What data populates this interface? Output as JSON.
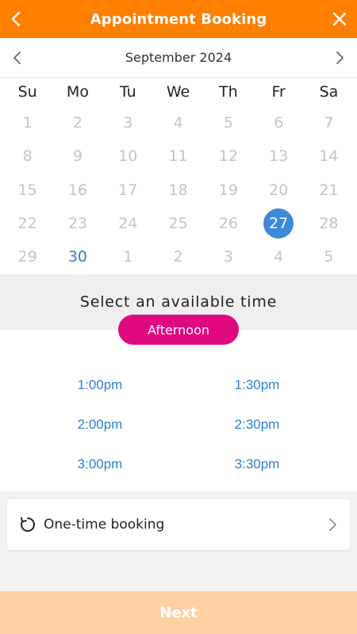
{
  "header": {
    "title": "Appointment Booking",
    "back_icon": "chevron-left-icon",
    "close_icon": "close-icon",
    "bg_color": "#ff7f00"
  },
  "calendar": {
    "month_label": "September 2024",
    "weekdays": [
      "Su",
      "Mo",
      "Tu",
      "We",
      "Th",
      "Fr",
      "Sa"
    ],
    "days": [
      {
        "label": "1",
        "state": "disabled"
      },
      {
        "label": "2",
        "state": "disabled"
      },
      {
        "label": "3",
        "state": "disabled"
      },
      {
        "label": "4",
        "state": "disabled"
      },
      {
        "label": "5",
        "state": "disabled"
      },
      {
        "label": "6",
        "state": "disabled"
      },
      {
        "label": "7",
        "state": "disabled"
      },
      {
        "label": "8",
        "state": "disabled"
      },
      {
        "label": "9",
        "state": "disabled"
      },
      {
        "label": "10",
        "state": "disabled"
      },
      {
        "label": "11",
        "state": "disabled"
      },
      {
        "label": "12",
        "state": "disabled"
      },
      {
        "label": "13",
        "state": "disabled"
      },
      {
        "label": "14",
        "state": "disabled"
      },
      {
        "label": "15",
        "state": "disabled"
      },
      {
        "label": "16",
        "state": "disabled"
      },
      {
        "label": "17",
        "state": "disabled"
      },
      {
        "label": "18",
        "state": "disabled"
      },
      {
        "label": "19",
        "state": "disabled"
      },
      {
        "label": "20",
        "state": "disabled"
      },
      {
        "label": "21",
        "state": "disabled"
      },
      {
        "label": "22",
        "state": "disabled"
      },
      {
        "label": "23",
        "state": "disabled"
      },
      {
        "label": "24",
        "state": "disabled"
      },
      {
        "label": "25",
        "state": "disabled"
      },
      {
        "label": "26",
        "state": "disabled"
      },
      {
        "label": "27",
        "state": "selected"
      },
      {
        "label": "28",
        "state": "disabled"
      },
      {
        "label": "29",
        "state": "disabled"
      },
      {
        "label": "30",
        "state": "available"
      },
      {
        "label": "1",
        "state": "disabled"
      },
      {
        "label": "2",
        "state": "disabled"
      },
      {
        "label": "3",
        "state": "disabled"
      },
      {
        "label": "4",
        "state": "disabled"
      },
      {
        "label": "5",
        "state": "disabled"
      }
    ],
    "selected_color": "#3b8ad9",
    "available_color": "#2f7fd1"
  },
  "time": {
    "prompt": "Select an available time",
    "period": "Afternoon",
    "period_color": "#e0087f",
    "slots": [
      "1:00pm",
      "1:30pm",
      "2:00pm",
      "2:30pm",
      "3:00pm",
      "3:30pm"
    ]
  },
  "booking": {
    "label": "One-time booking",
    "icon": "refresh-icon",
    "chevron_icon": "chevron-right-icon"
  },
  "footer": {
    "next_label": "Next",
    "next_color": "#ffd1a3"
  }
}
